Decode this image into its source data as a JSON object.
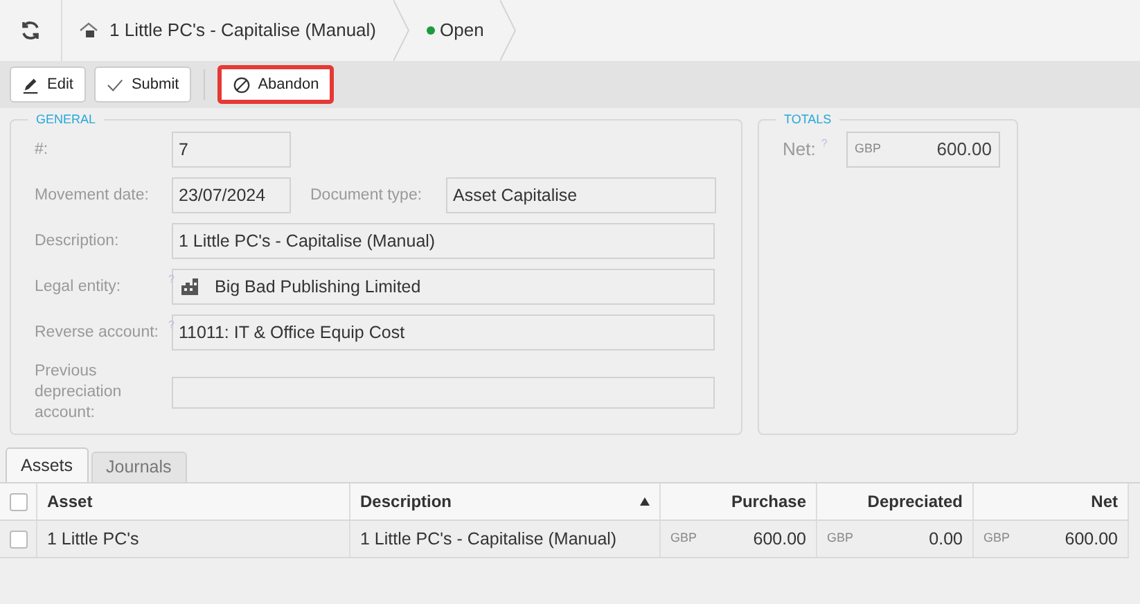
{
  "header": {
    "title": "1 Little PC's - Capitalise (Manual)",
    "status": "Open"
  },
  "toolbar": [
    {
      "label": "Edit",
      "kind": "edit",
      "highlighted": false
    },
    {
      "label": "Submit",
      "kind": "check",
      "highlighted": false
    },
    {
      "label": "Abandon",
      "kind": "ban",
      "highlighted": true
    }
  ],
  "general": {
    "title": "GENERAL",
    "rows": [
      {
        "fields": [
          {
            "label": "#:",
            "value": "7",
            "short": true
          }
        ]
      },
      {
        "fields": [
          {
            "label": "Movement date:",
            "value": "23/07/2024",
            "short": true
          },
          {
            "label": "Document type:",
            "value": "Asset Capitalise",
            "short": false
          }
        ]
      },
      {
        "fields": [
          {
            "label": "Description:",
            "value": "1 Little PC's - Capitalise (Manual)",
            "short": false
          }
        ]
      },
      {
        "fields": [
          {
            "label": "Legal entity:",
            "hint": "?",
            "value": "Big Bad Publishing Limited",
            "short": false,
            "kind": "entity"
          }
        ]
      },
      {
        "fields": [
          {
            "label": "Reverse account:",
            "hint": "?",
            "value": "11011: IT & Office Equip Cost",
            "short": false
          }
        ]
      },
      {
        "fields": [
          {
            "label": "Previous depreciation account:",
            "short": false
          }
        ]
      }
    ]
  },
  "totals": {
    "title": "TOTALS",
    "net": {
      "label": "Net:",
      "hint": "?",
      "currency": "GBP",
      "value": "600.00"
    }
  },
  "tabs": [
    {
      "label": "Assets",
      "selected": true
    },
    {
      "label": "Journals",
      "selected": false
    }
  ],
  "table": {
    "select_all": {
      "checked": false
    },
    "columns": [
      {
        "label": "Asset",
        "sorted": false
      },
      {
        "label": "Description",
        "sorted": true
      },
      {
        "label": "Purchase",
        "sorted": false
      },
      {
        "label": "Depreciated",
        "sorted": false
      },
      {
        "label": "Net",
        "sorted": false
      }
    ],
    "rows": [
      {
        "checked": false,
        "cells": [
          {
            "text": "1 Little PC's"
          },
          {
            "text": "1 Little PC's - Capitalise (Manual)"
          },
          {
            "currency": "GBP",
            "text": "600.00"
          },
          {
            "currency": "GBP",
            "text": "0.00"
          },
          {
            "currency": "GBP",
            "text": "600.00"
          }
        ]
      }
    ]
  }
}
